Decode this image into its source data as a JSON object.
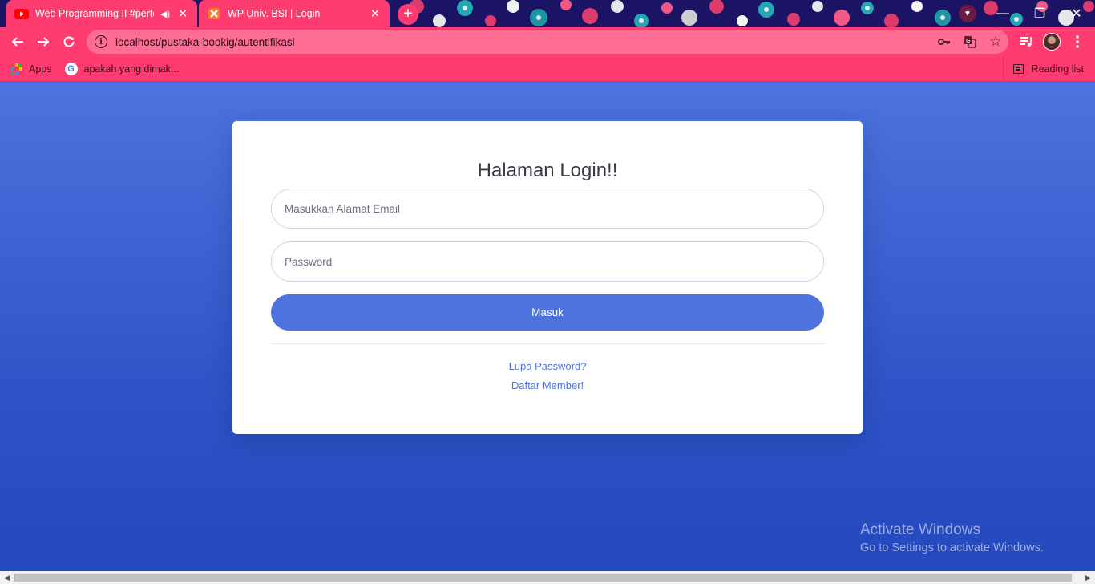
{
  "browser": {
    "tabs": [
      {
        "title": "Web Programming II #perten",
        "favicon": "youtube-icon",
        "audio": true,
        "active": false
      },
      {
        "title": "WP Univ. BSI | Login",
        "favicon": "xampp-icon",
        "active": true
      }
    ],
    "new_tab_label": "+",
    "address": "localhost/pustaka-bookig/autentifikasi",
    "bookmarks": [
      {
        "label": "Apps",
        "icon": "apps-grid-icon"
      },
      {
        "label": "apakah yang dimak...",
        "icon": "google-icon"
      }
    ],
    "reading_list_label": "Reading list",
    "accent_color": "#ff3c6f"
  },
  "login": {
    "title": "Halaman Login!!",
    "email_placeholder": "Masukkan Alamat Email",
    "password_placeholder": "Password",
    "submit_label": "Masuk",
    "forgot_label": "Lupa Password?",
    "register_label": "Daftar Member!",
    "primary_color": "#4e73df"
  },
  "watermark": {
    "line1": "Activate Windows",
    "line2": "Go to Settings to activate Windows."
  }
}
